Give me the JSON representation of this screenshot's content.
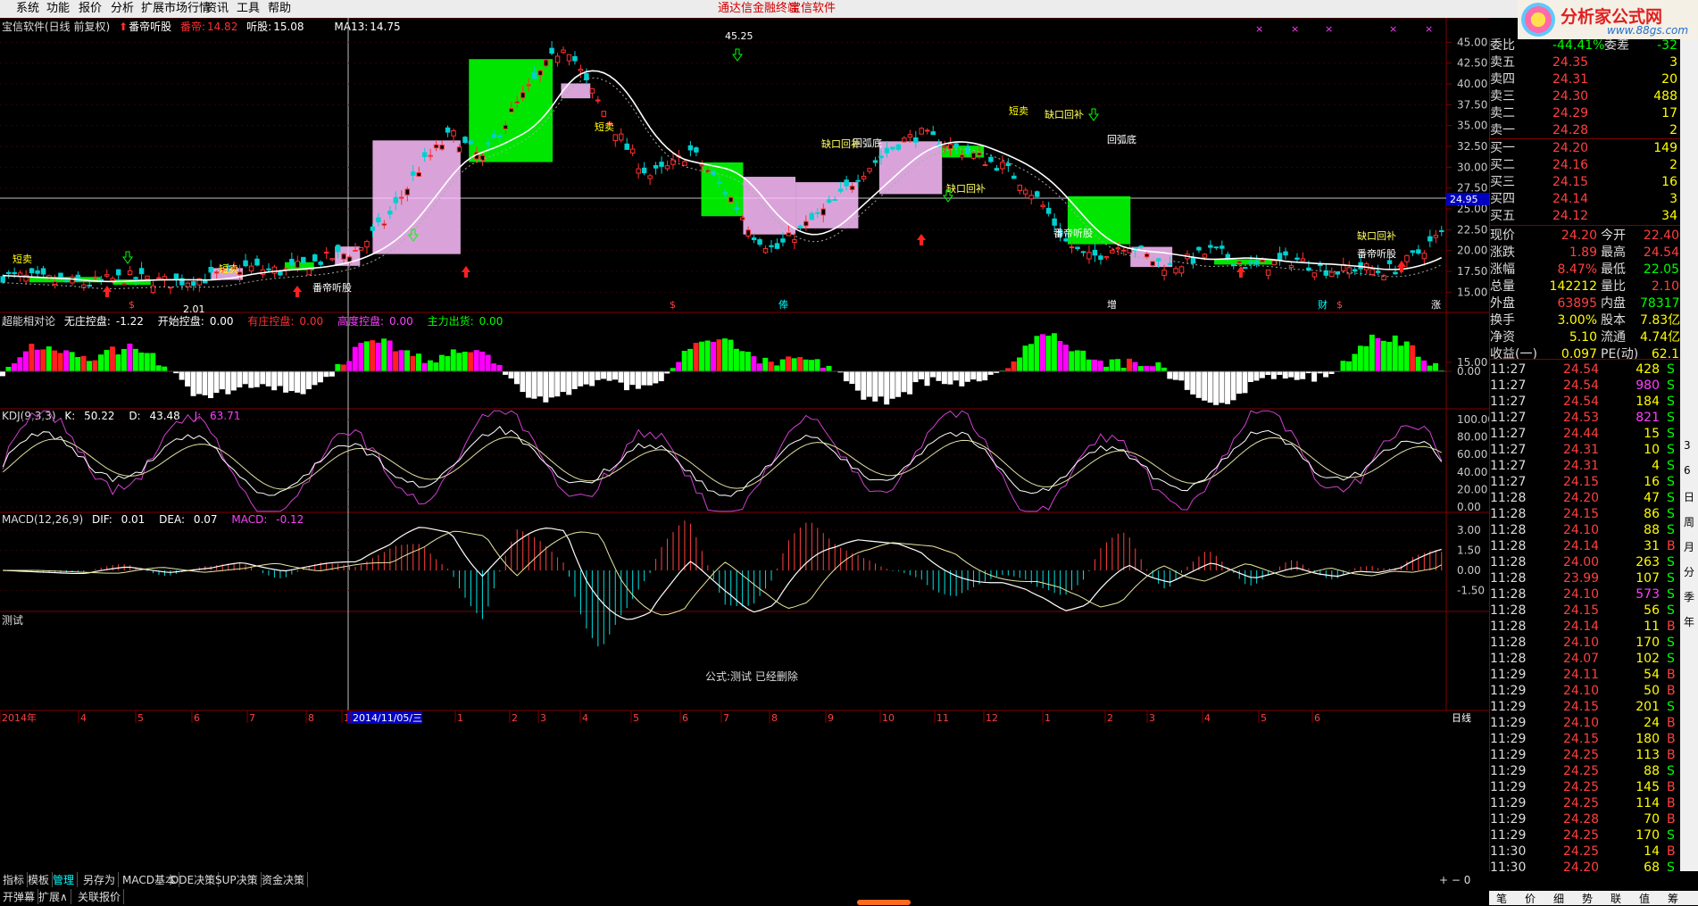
{
  "menu": {
    "items": [
      "系统",
      "功能",
      "报价",
      "分析",
      "扩展市场行情",
      "资讯",
      "工具",
      "帮助"
    ],
    "center_link_1": "通达信金融终端",
    "center_link_2": "宝信软件",
    "logo_text": "分析家公式网",
    "logo_url": "www.88gs.com"
  },
  "main_panel": {
    "title": "宝信软件(日线 前复权)",
    "indicator_name": "番帝听股",
    "label_fandi": "番帝:",
    "value_fandi": "14.82",
    "label_tinggu": "听股:",
    "value_tinggu": "15.08",
    "ma_label": "MA13:",
    "ma_value": "14.75",
    "high_label": "45.25",
    "low_label": "2.01",
    "price_tag": "24.95",
    "y_ticks": [
      "45.00",
      "42.50",
      "40.00",
      "37.50",
      "35.00",
      "32.50",
      "30.00",
      "27.50",
      "25.00",
      "22.50",
      "20.00",
      "17.50",
      "15.00"
    ],
    "signals": [
      "短卖",
      "短卖",
      "短卖",
      "短卖",
      "番帝听股",
      "番帝听股",
      "番帝听股",
      "回弧底",
      "回弧底",
      "缺口回补",
      "缺口回补",
      "缺口回补",
      "缺口回补"
    ],
    "bottom_marks": [
      "$",
      "$",
      "俸",
      "增",
      "财",
      "$",
      "涨"
    ]
  },
  "panel2": {
    "title": "超能相对论",
    "f1_label": "无庄控盘:",
    "f1_value": "-1.22",
    "f2_label": "开始控盘:",
    "f2_value": "0.00",
    "f3_label": "有庄控盘:",
    "f3_value": "0.00",
    "f4_label": "高度控盘:",
    "f4_value": "0.00",
    "f5_label": "主力出货:",
    "f5_value": "0.00",
    "y_ticks": [
      "15.00",
      "0.00"
    ]
  },
  "panel3": {
    "title": "KDJ(9,3,3)",
    "k_label": "K:",
    "k_value": "50.22",
    "d_label": "D:",
    "d_value": "43.48",
    "j_label": "J:",
    "j_value": "63.71",
    "y_ticks": [
      "100.00",
      "80.00",
      "60.00",
      "40.00",
      "20.00",
      "0.00"
    ]
  },
  "panel4": {
    "title": "MACD(12,26,9)",
    "dif_label": "DIF:",
    "dif_value": "0.01",
    "dea_label": "DEA:",
    "dea_value": "0.07",
    "macd_label": "MACD:",
    "macd_value": "-0.12",
    "y_ticks": [
      "3.00",
      "1.50",
      "0.00",
      "-1.50"
    ]
  },
  "panel5": {
    "title": "测试",
    "message": "公式:测试 已经删除"
  },
  "time_axis": {
    "labels": [
      "2014年",
      "4",
      "5",
      "6",
      "7",
      "8",
      "1",
      "2014/11/05/三",
      "1",
      "2",
      "3",
      "4",
      "5",
      "6",
      "7",
      "8",
      "9",
      "10",
      "11",
      "12",
      "1",
      "2",
      "3",
      "4",
      "5",
      "6"
    ],
    "period": "日线"
  },
  "bottom_tabs": [
    "指标",
    "模板",
    "管理",
    "另存为",
    "MACD基本",
    "DDE决策",
    "SUP决策",
    "资金决策"
  ],
  "bottom_tabs2": [
    "开弹幕",
    "扩展∧",
    "关联报价"
  ],
  "quote": {
    "header_label": "委比",
    "header_value": "-44.41%",
    "header_label2": "委差",
    "header_value2": "-32",
    "asks": [
      {
        "label": "卖五",
        "price": "24.35",
        "vol": "3"
      },
      {
        "label": "卖四",
        "price": "24.31",
        "vol": "20"
      },
      {
        "label": "卖三",
        "price": "24.30",
        "vol": "488"
      },
      {
        "label": "卖二",
        "price": "24.29",
        "vol": "17"
      },
      {
        "label": "卖一",
        "price": "24.28",
        "vol": "2"
      }
    ],
    "bids": [
      {
        "label": "买一",
        "price": "24.20",
        "vol": "149"
      },
      {
        "label": "买二",
        "price": "24.16",
        "vol": "2"
      },
      {
        "label": "买三",
        "price": "24.15",
        "vol": "16"
      },
      {
        "label": "买四",
        "price": "24.14",
        "vol": "3"
      },
      {
        "label": "买五",
        "price": "24.12",
        "vol": "34"
      }
    ],
    "stats": [
      {
        "l1": "现价",
        "v1": "24.20",
        "l2": "今开",
        "v2": "22.40"
      },
      {
        "l1": "涨跌",
        "v1": "1.89",
        "l2": "最高",
        "v2": "24.54"
      },
      {
        "l1": "涨幅",
        "v1": "8.47%",
        "l2": "最低",
        "v2": "22.05"
      },
      {
        "l1": "总量",
        "v1": "142212",
        "l2": "量比",
        "v2": "2.10"
      },
      {
        "l1": "外盘",
        "v1": "63895",
        "l2": "内盘",
        "v2": "78317"
      },
      {
        "l1": "换手",
        "v1": "3.00%",
        "l2": "股本",
        "v2": "7.83亿"
      },
      {
        "l1": "净资",
        "v1": "5.10",
        "l2": "流通",
        "v2": "4.74亿"
      },
      {
        "l1": "收益(一)",
        "v1": "0.097",
        "l2": "PE(动)",
        "v2": "62.1"
      }
    ],
    "ticks": [
      {
        "t": "11:27",
        "p": "24.54",
        "v": "428",
        "s": "S"
      },
      {
        "t": "11:27",
        "p": "24.54",
        "v": "980",
        "s": "S"
      },
      {
        "t": "11:27",
        "p": "24.54",
        "v": "184",
        "s": "S"
      },
      {
        "t": "11:27",
        "p": "24.53",
        "v": "821",
        "s": "S"
      },
      {
        "t": "11:27",
        "p": "24.44",
        "v": "15",
        "s": "S"
      },
      {
        "t": "11:27",
        "p": "24.31",
        "v": "10",
        "s": "S"
      },
      {
        "t": "11:27",
        "p": "24.31",
        "v": "4",
        "s": "S"
      },
      {
        "t": "11:27",
        "p": "24.15",
        "v": "16",
        "s": "S"
      },
      {
        "t": "11:28",
        "p": "24.20",
        "v": "47",
        "s": "S"
      },
      {
        "t": "11:28",
        "p": "24.15",
        "v": "86",
        "s": "S"
      },
      {
        "t": "11:28",
        "p": "24.10",
        "v": "88",
        "s": "S"
      },
      {
        "t": "11:28",
        "p": "24.14",
        "v": "31",
        "s": "B"
      },
      {
        "t": "11:28",
        "p": "24.00",
        "v": "263",
        "s": "S"
      },
      {
        "t": "11:28",
        "p": "23.99",
        "v": "107",
        "s": "S"
      },
      {
        "t": "11:28",
        "p": "24.10",
        "v": "573",
        "s": "S"
      },
      {
        "t": "11:28",
        "p": "24.15",
        "v": "56",
        "s": "S"
      },
      {
        "t": "11:28",
        "p": "24.14",
        "v": "11",
        "s": "B"
      },
      {
        "t": "11:28",
        "p": "24.10",
        "v": "170",
        "s": "S"
      },
      {
        "t": "11:28",
        "p": "24.07",
        "v": "102",
        "s": "S"
      },
      {
        "t": "11:29",
        "p": "24.11",
        "v": "54",
        "s": "B"
      },
      {
        "t": "11:29",
        "p": "24.10",
        "v": "50",
        "s": "B"
      },
      {
        "t": "11:29",
        "p": "24.15",
        "v": "201",
        "s": "S"
      },
      {
        "t": "11:29",
        "p": "24.10",
        "v": "24",
        "s": "B"
      },
      {
        "t": "11:29",
        "p": "24.15",
        "v": "180",
        "s": "B"
      },
      {
        "t": "11:29",
        "p": "24.25",
        "v": "113",
        "s": "B"
      },
      {
        "t": "11:29",
        "p": "24.25",
        "v": "88",
        "s": "S"
      },
      {
        "t": "11:29",
        "p": "24.25",
        "v": "145",
        "s": "B"
      },
      {
        "t": "11:29",
        "p": "24.25",
        "v": "114",
        "s": "B"
      },
      {
        "t": "11:29",
        "p": "24.28",
        "v": "70",
        "s": "B"
      },
      {
        "t": "11:29",
        "p": "24.25",
        "v": "170",
        "s": "S"
      },
      {
        "t": "11:30",
        "p": "24.25",
        "v": "14",
        "s": "B"
      },
      {
        "t": "11:30",
        "p": "24.20",
        "v": "68",
        "s": "S"
      }
    ]
  },
  "side_strip": [
    "3",
    "6",
    "日",
    "周",
    "月",
    "分",
    "季",
    "年"
  ],
  "right_bottom_tabs": [
    "笔",
    "价",
    "细",
    "势",
    "联",
    "值",
    "筹"
  ],
  "colors": {
    "up": "#ff3030",
    "down": "#00d0d0",
    "green": "#00ff00",
    "pink": "#ffc0ff",
    "magenta": "#ff00ff",
    "yellow": "#ffff00",
    "red_border": "#800000"
  }
}
